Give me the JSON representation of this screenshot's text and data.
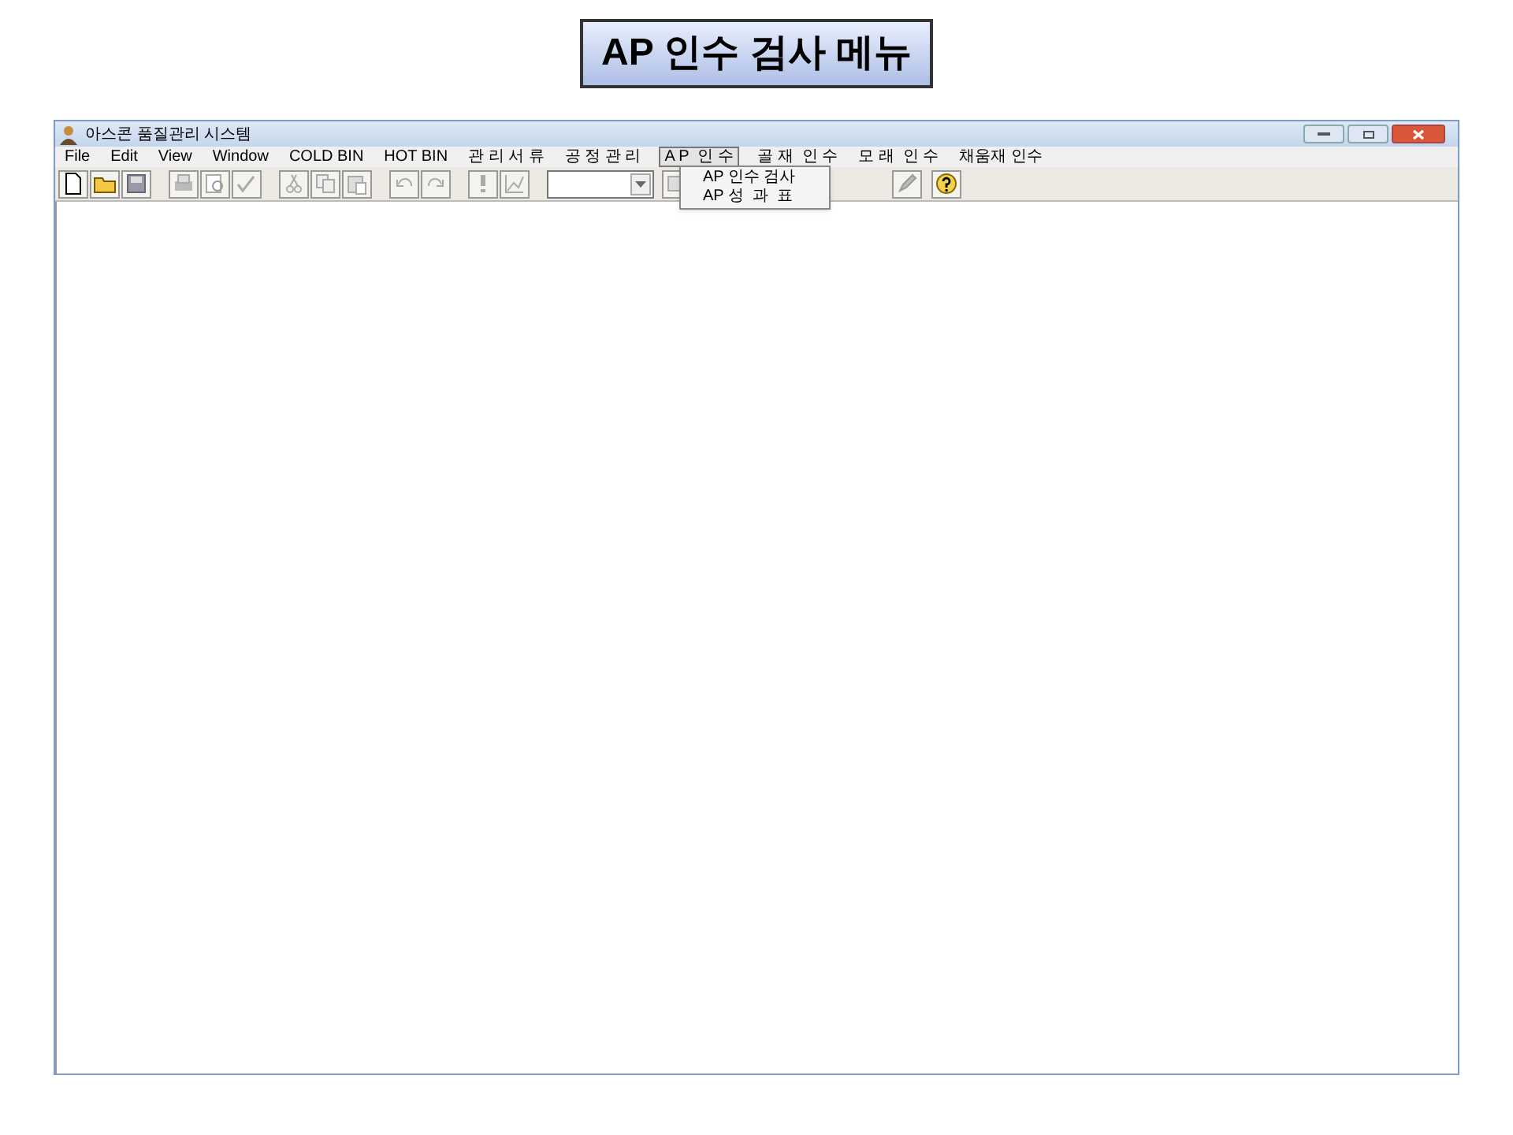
{
  "slide_title": "AP 인수 검사 메뉴",
  "window": {
    "title": "아스콘 품질관리 시스템"
  },
  "menu": [
    {
      "label": "File",
      "selected": false
    },
    {
      "label": "Edit",
      "selected": false
    },
    {
      "label": "View",
      "selected": false
    },
    {
      "label": "Window",
      "selected": false
    },
    {
      "label": "COLD BIN",
      "selected": false
    },
    {
      "label": "HOT BIN",
      "selected": false
    },
    {
      "label": "관 리 서 류",
      "selected": false
    },
    {
      "label": "공 정 관 리",
      "selected": false
    },
    {
      "label": "A P  인 수",
      "selected": true
    },
    {
      "label": "골 재  인 수",
      "selected": false
    },
    {
      "label": "모 래  인 수",
      "selected": false
    },
    {
      "label": "채움재 인수",
      "selected": false
    }
  ],
  "dropdown": [
    {
      "label": "AP 인수 검사"
    },
    {
      "label": "AP 성  과  표"
    }
  ]
}
